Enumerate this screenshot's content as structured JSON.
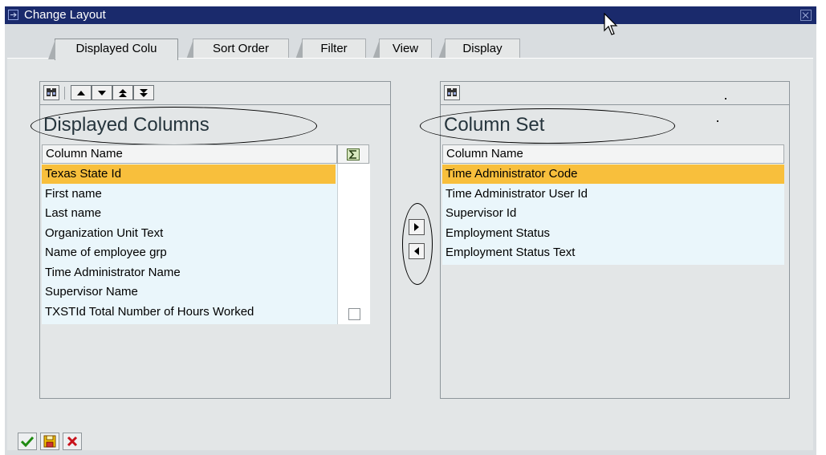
{
  "window": {
    "title": "Change Layout"
  },
  "tabs": [
    {
      "label": "Displayed Colu",
      "active": true
    },
    {
      "label": "Sort Order",
      "active": false
    },
    {
      "label": "Filter",
      "active": false
    },
    {
      "label": "View",
      "active": false
    },
    {
      "label": "Display",
      "active": false
    }
  ],
  "left_panel": {
    "heading": "Displayed Columns",
    "column_header": "Column Name",
    "sum_icon": "sigma-icon",
    "rows": [
      {
        "label": "Texas State Id",
        "selected": true
      },
      {
        "label": "First name"
      },
      {
        "label": "Last name"
      },
      {
        "label": "Organization Unit Text"
      },
      {
        "label": "Name of employee grp"
      },
      {
        "label": "Time Administrator Name"
      },
      {
        "label": "Supervisor Name"
      },
      {
        "label": "TXSTId Total Number of Hours Worked",
        "checkbox": false
      }
    ],
    "toolbar_icons": [
      "find-icon",
      "move-up-icon",
      "move-down-icon",
      "move-top-icon",
      "move-bottom-icon"
    ]
  },
  "right_panel": {
    "heading": "Column Set",
    "column_header": "Column Name",
    "rows": [
      {
        "label": "Time Administrator Code",
        "selected": true
      },
      {
        "label": "Time Administrator User Id"
      },
      {
        "label": "Supervisor Id"
      },
      {
        "label": "Employment Status"
      },
      {
        "label": "Employment Status Text"
      }
    ],
    "toolbar_icons": [
      "find-icon"
    ]
  },
  "transfer_buttons": [
    "move-left-to-right-icon",
    "move-right-to-left-icon"
  ],
  "footer_buttons": [
    "confirm-icon",
    "save-layout-icon",
    "cancel-icon"
  ],
  "colors": {
    "titlebar": "#1a2a6c",
    "selected_row": "#f8bf3c",
    "grid_body": "#eaf6fb",
    "dialog_bg": "#d9dde0"
  }
}
